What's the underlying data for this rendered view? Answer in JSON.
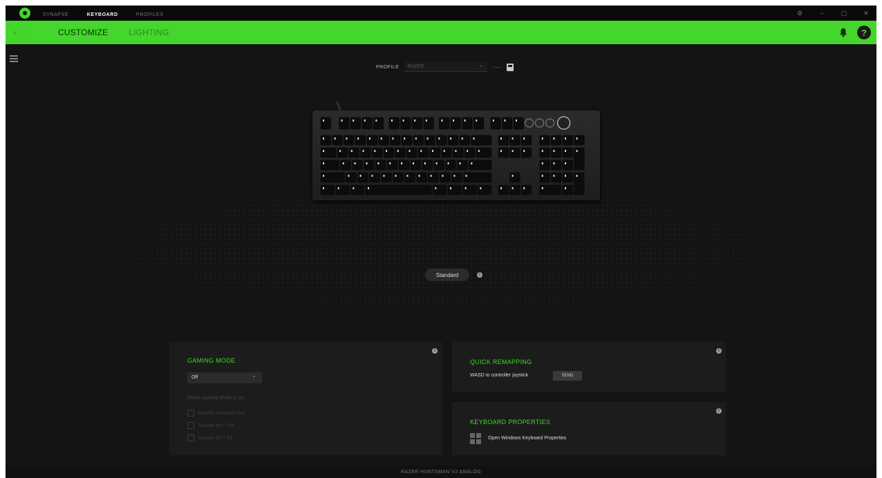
{
  "titlebar": {
    "nav": [
      "SYNAPSE",
      "KEYBOARD",
      "PROFILES"
    ],
    "active_nav": "KEYBOARD",
    "controls": [
      "⚙",
      "–",
      "▢",
      "✕"
    ]
  },
  "subbar": {
    "back": "‹",
    "forward": "›",
    "tabs": {
      "customize": "CUSTOMIZE",
      "lighting": "LIGHTING"
    },
    "help": "?",
    "accent": "#44d62c"
  },
  "profile": {
    "label": "PROFILE",
    "value": "RAZER",
    "more": "···"
  },
  "mode_button": {
    "label": "Standard"
  },
  "gaming_mode": {
    "title": "GAMING MODE",
    "selected": "Off",
    "when_label": "When Gaming Mode is On",
    "options": [
      "Disable Windows Key",
      "Disable Alt + Tab",
      "Disable Alt + F4"
    ]
  },
  "quick_remapping": {
    "title": "QUICK REMAPPING",
    "description": "WASD to controller joystick",
    "button": "SEND"
  },
  "keyboard_properties": {
    "title": "KEYBOARD PROPERTIES",
    "link": "Open Windows Keyboard Properties"
  },
  "footer": {
    "device": "RAZER HUNTSMAN V2 ANALOG"
  }
}
